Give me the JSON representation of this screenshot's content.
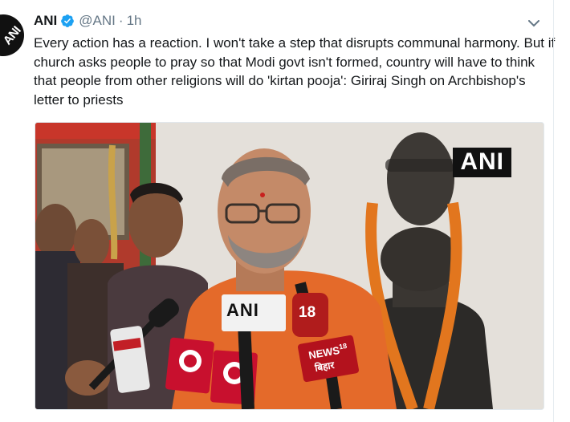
{
  "tweet": {
    "name": "ANI",
    "handle": "@ANI",
    "separator": "·",
    "time": "1h",
    "avatar_logo": "ANI",
    "text": "Every action has a reaction. I won't take a step that disrupts communal harmony. But if church asks people to pray so that Modi govt isn't formed, country will have to think that people from other religions will do 'kirtan pooja': Giriraj Singh on Archbishop's letter to priests",
    "icons": {
      "verified": "verified-badge-icon",
      "caret": "chevron-down-icon"
    },
    "colors": {
      "verified": "#1da1f2",
      "handle": "#657786"
    }
  },
  "media": {
    "watermark": "ANI",
    "mic_labels": {
      "ani": "ANI",
      "ch18": "18",
      "news18": "NEWS",
      "news18_num": "18",
      "bihar": "बिहार"
    }
  }
}
